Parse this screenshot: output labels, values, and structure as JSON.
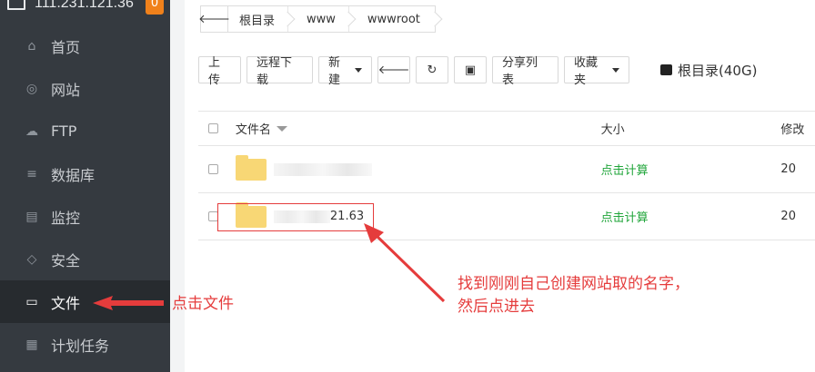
{
  "server": {
    "ip": "111.231.121.36",
    "badge": "0"
  },
  "sidebar": {
    "items": [
      {
        "label": "首页",
        "icon": "home-icon",
        "glyph": "⌂"
      },
      {
        "label": "网站",
        "icon": "globe-icon",
        "glyph": "◎"
      },
      {
        "label": "FTP",
        "icon": "ftp-icon",
        "glyph": "☁"
      },
      {
        "label": "数据库",
        "icon": "database-icon",
        "glyph": "≡"
      },
      {
        "label": "监控",
        "icon": "monitor-chart-icon",
        "glyph": "▤"
      },
      {
        "label": "安全",
        "icon": "shield-icon",
        "glyph": "◇"
      },
      {
        "label": "文件",
        "icon": "folder-icon",
        "glyph": "▭"
      },
      {
        "label": "计划任务",
        "icon": "calendar-icon",
        "glyph": "▦"
      }
    ]
  },
  "breadcrumb": {
    "back_glyph": "🡐",
    "items": [
      "根目录",
      "www",
      "wwwroot"
    ]
  },
  "toolbar": {
    "upload": "上传",
    "remote_download": "远程下载",
    "new": "新建",
    "back_glyph": "🡐",
    "refresh_glyph": "↻",
    "terminal_glyph": "▣",
    "share_list": "分享列表",
    "favorites": "收藏夹",
    "disk": "根目录(40G)"
  },
  "table": {
    "headers": {
      "name": "文件名",
      "size": "大小",
      "modified": "修改"
    },
    "rows": [
      {
        "name_suffix": "",
        "size": "点击计算",
        "date": "20"
      },
      {
        "name_suffix": "21.63",
        "size": "点击计算",
        "date": "20"
      }
    ]
  },
  "annotations": {
    "file_hint": "点击文件",
    "folder_hint_line1": "找到刚刚自己创建网站取的名字，",
    "folder_hint_line2": "然后点进去"
  },
  "colors": {
    "sidebar_bg": "#353a40",
    "active_bg": "#272b2f",
    "badge": "#f0811b",
    "accent_green": "#20a53a",
    "annotation_red": "#e53c3c"
  }
}
